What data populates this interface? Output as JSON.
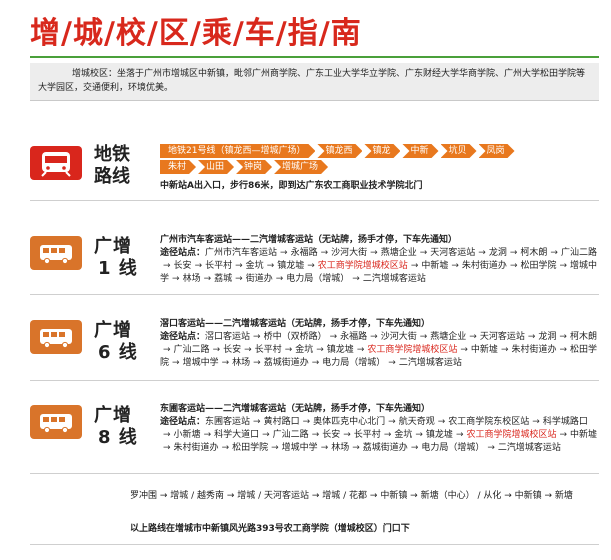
{
  "title": "增/城/校/区/乘/车/指/南",
  "intro": "增城校区：坐落于广州市增城区中新镇，毗邻广州商学院、广东工业大学华立学院、广东财经大学华商学院、广州大学松田学院等大学园区，交通便利，环境优美。",
  "metro": {
    "label_line1": "地铁",
    "label_line2": "路线",
    "row1": [
      "地铁21号线（镇龙西—增城广场）",
      "镇龙西",
      "镇龙",
      "中新",
      "坑贝",
      "凤岗"
    ],
    "row2": [
      "朱村",
      "山田",
      "钟岗",
      "增城广场"
    ],
    "note": "中新站A出入口，步行86米，即到达广东农工商职业技术学院北门"
  },
  "routes": [
    {
      "label_line1": "广增",
      "label_line2": "1 线",
      "head": "广州市汽车客运站——二汽增城客运站（无站牌，扬手才停，下车先通知）",
      "prefix": "途径站点：",
      "stops": [
        {
          "t": "广州市汽车客运站",
          "red": false
        },
        {
          "t": "永福路",
          "red": false
        },
        {
          "t": "沙河大街",
          "red": false
        },
        {
          "t": "燕塘企业",
          "red": false
        },
        {
          "t": "天河客运站",
          "red": false
        },
        {
          "t": "龙洞",
          "red": false
        },
        {
          "t": "柯木朗",
          "red": false
        },
        {
          "t": "广汕二路",
          "red": false
        },
        {
          "t": "长安",
          "red": false
        },
        {
          "t": "长平村",
          "red": false
        },
        {
          "t": "金坑",
          "red": false
        },
        {
          "t": "镇龙墟",
          "red": false
        },
        {
          "t": "农工商学院增城校区站",
          "red": true
        },
        {
          "t": "中新墟",
          "red": false
        },
        {
          "t": "朱村街道办",
          "red": false
        },
        {
          "t": "松田学院",
          "red": false
        },
        {
          "t": "增城中学",
          "red": false
        },
        {
          "t": "林场",
          "red": false
        },
        {
          "t": "荔城",
          "red": false
        },
        {
          "t": "街道办",
          "red": false
        },
        {
          "t": "电力局（增城）",
          "red": false
        },
        {
          "t": "二汽增城客运站",
          "red": false
        }
      ]
    },
    {
      "label_line1": "广增",
      "label_line2": "6 线",
      "head": "滘口客运站——二汽增城客运站（无站牌，扬手才停，下车先通知）",
      "prefix": "途径站点：",
      "stops": [
        {
          "t": "滘口客运站",
          "red": false
        },
        {
          "t": "桥中（双桥路）",
          "red": false
        },
        {
          "t": "永福路",
          "red": false
        },
        {
          "t": "沙河大街",
          "red": false
        },
        {
          "t": "燕塘企业",
          "red": false
        },
        {
          "t": "天河客运站",
          "red": false
        },
        {
          "t": "龙洞",
          "red": false
        },
        {
          "t": "柯木朗",
          "red": false
        },
        {
          "t": "广汕二路",
          "red": false
        },
        {
          "t": "长安",
          "red": false
        },
        {
          "t": "长平村",
          "red": false
        },
        {
          "t": "金坑",
          "red": false
        },
        {
          "t": "镇龙墟",
          "red": false
        },
        {
          "t": "农工商学院增城校区站",
          "red": true
        },
        {
          "t": "中新墟",
          "red": false
        },
        {
          "t": "朱村街道办",
          "red": false
        },
        {
          "t": "松田学院",
          "red": false
        },
        {
          "t": "增城中学",
          "red": false
        },
        {
          "t": "林场",
          "red": false
        },
        {
          "t": "荔城街道办",
          "red": false
        },
        {
          "t": "电力局（增城）",
          "red": false
        },
        {
          "t": "二汽增城客运站",
          "red": false
        }
      ]
    },
    {
      "label_line1": "广增",
      "label_line2": "8 线",
      "head": "东圃客运站——二汽增城客运站（无站牌，扬手才停，下车先通知）",
      "prefix": "途径站点：",
      "stops": [
        {
          "t": "东圃客运站",
          "red": false
        },
        {
          "t": "黄村路口",
          "red": false
        },
        {
          "t": "奥体匹克中心北门",
          "red": false
        },
        {
          "t": "航天奇观",
          "red": false
        },
        {
          "t": "农工商学院东校区站",
          "red": false
        },
        {
          "t": "科学城路口",
          "red": false
        },
        {
          "t": "小新塘",
          "red": false
        },
        {
          "t": "科学大道口",
          "red": false
        },
        {
          "t": "广汕二路",
          "red": false
        },
        {
          "t": "长安",
          "red": false
        },
        {
          "t": "长平村",
          "red": false
        },
        {
          "t": "金坑",
          "red": false
        },
        {
          "t": "镇龙墟",
          "red": false
        },
        {
          "t": "农工商学院增城校区站",
          "red": true
        },
        {
          "t": "中新墟",
          "red": false
        },
        {
          "t": "朱村街道办",
          "red": false
        },
        {
          "t": "松田学院",
          "red": false
        },
        {
          "t": "增城中学",
          "red": false
        },
        {
          "t": "林场",
          "red": false
        },
        {
          "t": "荔城街道办",
          "red": false
        },
        {
          "t": "电力局（增城）",
          "red": false
        },
        {
          "t": "二汽增城客运站",
          "red": false
        }
      ]
    }
  ],
  "other_routes": "罗冲围 → 增城 / 越秀南 → 增城 / 天河客运站 → 增城 / 花都 → 中新镇 → 新塘（中心） / 从化 → 中新镇 → 新塘",
  "footer": "以上路线在增城市中新镇风光路393号农工商学院（增城校区）门口下",
  "colors": {
    "title_red": "#d8281c",
    "accent_green": "#4aa03a",
    "metro_orange": "#e8781e",
    "bus_orange": "#d9742a"
  }
}
